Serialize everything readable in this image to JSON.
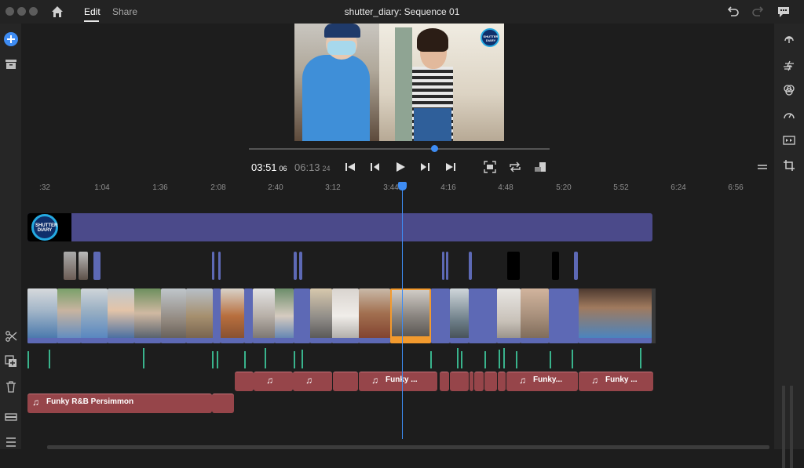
{
  "header": {
    "tabs": [
      {
        "label": "Edit",
        "active": true
      },
      {
        "label": "Share",
        "active": false
      }
    ],
    "title": "shutter_diary: Sequence 01"
  },
  "player": {
    "current_time": "03:51",
    "current_frames": "06",
    "total_time": "06:13",
    "total_frames": "24",
    "scrub_progress": 0.61,
    "preview_logo_text": "SHUTTER DIARY"
  },
  "ruler": {
    "ticks": [
      ":32",
      "1:04",
      "1:36",
      "2:08",
      "2:40",
      "3:12",
      "3:44",
      "4:16",
      "4:48",
      "5:20",
      "5:52",
      "6:24",
      "6:56"
    ]
  },
  "timeline": {
    "title_logo_text": "SHUTTER DIARY",
    "audio_clips": [
      {
        "label": "",
        "note": "♫"
      },
      {
        "label": "",
        "note": "♫"
      },
      {
        "label": "Funky ...",
        "note": "♫"
      },
      {
        "label": "Funky...",
        "note": "♫"
      },
      {
        "label": "Funky ...",
        "note": "♫"
      }
    ],
    "music_track": {
      "label": "Funky R&B Persimmon",
      "note": "♫"
    }
  },
  "colors": {
    "accent": "#3e8cf3",
    "title_track": "#4b4a8a",
    "audio_clip": "#96454a",
    "waveform": "#39b38c",
    "selected_clip": "#f29a2e"
  },
  "icons": {
    "left_toolbar": [
      "add-icon",
      "library-icon",
      "scissors-icon",
      "duplicate-icon",
      "trash-icon",
      "track-icon",
      "list-icon"
    ],
    "right_toolbar": [
      "export-icon",
      "effects-icon",
      "color-icon",
      "speed-icon",
      "transitions-icon",
      "crop-icon"
    ]
  }
}
